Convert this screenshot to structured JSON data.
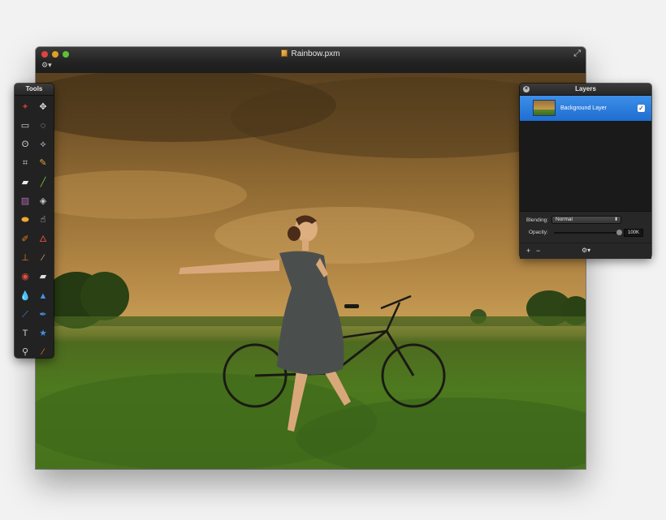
{
  "window": {
    "title": "Rainbow.pxm",
    "doc_icon": "pixelmator-document-icon",
    "gear_menu": "⚙▾",
    "fullscreen": "⤢"
  },
  "tools_panel": {
    "title": "Tools",
    "tools": [
      {
        "name": "magic-wand-icon",
        "glyph": "✦",
        "color": "#c0392b"
      },
      {
        "name": "move-tool-icon",
        "glyph": "✥",
        "color": "#e0e0e0"
      },
      {
        "name": "rect-select-icon",
        "glyph": "▭",
        "color": "#d0d0d0"
      },
      {
        "name": "ellipse-select-icon",
        "glyph": "◌",
        "color": "#d0d0d0"
      },
      {
        "name": "lasso-icon",
        "glyph": "ʘ",
        "color": "#d0d0d0"
      },
      {
        "name": "polygon-lasso-icon",
        "glyph": "⟡",
        "color": "#d0d0d0"
      },
      {
        "name": "crop-icon",
        "glyph": "⌗",
        "color": "#d0d0d0"
      },
      {
        "name": "eyedropper-icon",
        "glyph": "✎",
        "color": "#e6a23c"
      },
      {
        "name": "eraser-icon",
        "glyph": "▰",
        "color": "#e9e9e9"
      },
      {
        "name": "pencil-icon",
        "glyph": "╱",
        "color": "#7bc043"
      },
      {
        "name": "gradient-icon",
        "glyph": "▨",
        "color": "#b06ab3"
      },
      {
        "name": "paint-bucket-icon",
        "glyph": "◈",
        "color": "#c8c8c8"
      },
      {
        "name": "sponge-icon",
        "glyph": "⬬",
        "color": "#f0a830"
      },
      {
        "name": "smudge-icon",
        "glyph": "☝",
        "color": "#e0e0e0"
      },
      {
        "name": "brush-icon",
        "glyph": "✐",
        "color": "#e67e22"
      },
      {
        "name": "burn-icon",
        "glyph": "🜂",
        "color": "#e74c3c"
      },
      {
        "name": "clone-stamp-icon",
        "glyph": "⊥",
        "color": "#e67e22"
      },
      {
        "name": "healing-icon",
        "glyph": "⁄",
        "color": "#e8a060"
      },
      {
        "name": "red-eye-icon",
        "glyph": "◉",
        "color": "#e74c3c"
      },
      {
        "name": "magic-eraser-icon",
        "glyph": "▰",
        "color": "#e0e0e0"
      },
      {
        "name": "blur-icon",
        "glyph": "💧",
        "color": "#4a90e2"
      },
      {
        "name": "sharpen-icon",
        "glyph": "▲",
        "color": "#4a90e2"
      },
      {
        "name": "pen-icon",
        "glyph": "⟋",
        "color": "#4a90e2"
      },
      {
        "name": "freeform-pen-icon",
        "glyph": "✒",
        "color": "#4a90e2"
      },
      {
        "name": "type-icon",
        "glyph": "T",
        "color": "#d0d0d0"
      },
      {
        "name": "shape-icon",
        "glyph": "★",
        "color": "#3d8fe8"
      },
      {
        "name": "zoom-icon",
        "glyph": "⚲",
        "color": "#d0d0d0"
      },
      {
        "name": "color-picker-icon",
        "glyph": "⁄",
        "color": "#e67e22"
      }
    ]
  },
  "layers_panel": {
    "title": "Layers",
    "layers": [
      {
        "name": "Background Layer",
        "visible": true
      }
    ],
    "blending_label": "Blending:",
    "blending_value": "Normal",
    "opacity_label": "Opacity:",
    "opacity_value": "100K",
    "opacity_level": 1.0,
    "footer": {
      "add": "+",
      "remove": "−",
      "gear": "⚙▾"
    }
  },
  "colors": {
    "accent": "#1f6dd1",
    "sky_top": "#5a4120",
    "sky_bottom": "#c59a52",
    "field": "#4c7a1e"
  }
}
